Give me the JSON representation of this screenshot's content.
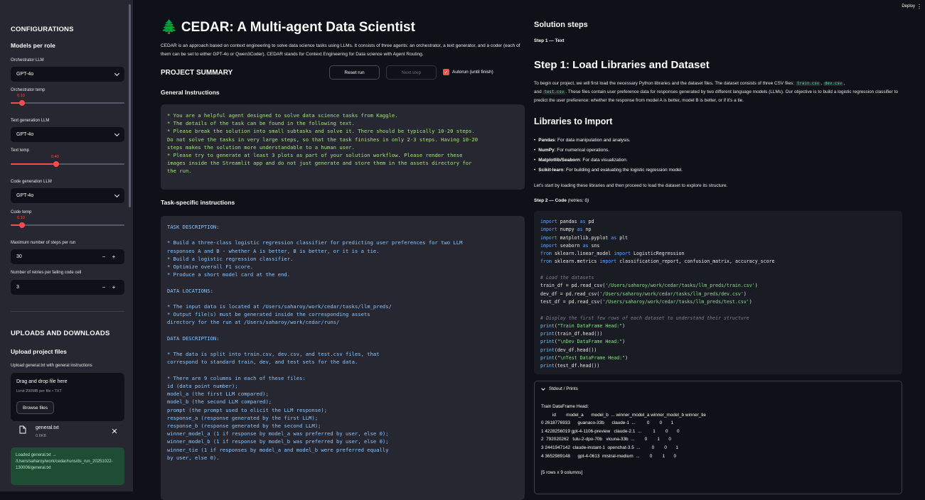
{
  "toolbar": {
    "deploy": "Deploy",
    "menu": "⋮"
  },
  "sidebar": {
    "configurations": "CONFIGURATIONS",
    "models_per_role": "Models per role",
    "orchestrator_llm_label": "Orchestrator LLM",
    "orchestrator_llm": "GPT-4o",
    "orchestrator_temp_label": "Orchestrator temp",
    "orchestrator_temp": "0.10",
    "orchestrator_temp_fraction": 0.1,
    "text_llm_label": "Text generation LLM",
    "text_llm": "GPT-4o",
    "text_temp_label": "Text temp",
    "text_temp": "0.40",
    "text_temp_fraction": 0.4,
    "code_llm_label": "Code generation LLM",
    "code_llm": "GPT-4o",
    "code_temp_label": "Code temp",
    "code_temp": "0.10",
    "code_temp_fraction": 0.1,
    "max_steps_label": "Maximum number of steps per run",
    "max_steps": "30",
    "retries_label": "Number of retries per failing code cell",
    "retries": "3",
    "minus": "−",
    "plus": "+",
    "uploads_downloads": "UPLOADS AND DOWNLOADS",
    "upload_project_files": "Upload project files",
    "upload_general_label": "Upload general.txt with general instructions",
    "drag_drop": "Drag and drop file here",
    "limit": "Limit 200MB per file • TXT",
    "browse": "Browse files",
    "file_name": "general.txt",
    "file_size": "0.6KB",
    "success": "Loaded general.txt → /Users/saharoy/work/cedar/runs/ds_run_20251022-130006/general.txt"
  },
  "main": {
    "title": "🌲 CEDAR: A Multi-agent Data Scientist",
    "intro": "CEDAR is an approach based on context engineering to solve data science tasks using LLMs. It consists of three agents: an orchestrator, a text generator, and a coder (each of them can be set to either GPT-4o or Qwen3Coder). CEDAR stands for Context Engineering for Data science with Agent Routing.",
    "project_summary": "PROJECT SUMMARY",
    "reset_run": "Reset run",
    "next_step": "Next step",
    "autorun": "Autorun (until finish)",
    "general_instructions": "General Instructions",
    "general_text": "* You are a helpful agent designed to solve data science tasks from Kaggle.\n* The details of the task can be found in the following text.\n* Please break the solution into small subtasks and solve it. There should be typically 10-20 steps.\nDo not solve the tasks in very large steps, so that the task finishes in only 2-3 steps. Having 10-20\nsteps makes the solution more understandable to a human user.\n* Please try to generate at least 3 plots as part of your solution workflow. Please render these\nimages inside the Streamlit app and do not just generate and store them in the assets directory for\nthe run.",
    "task_specific": "Task-specific instructions",
    "task_text": "TASK DESCRIPTION:\n\n* Build a three-class logistic regression classifier for predicting user preferences for two LLM\nresponses A and B - whether A is better, B is better, or it is a tie.\n* Build a logistic regression classifier.\n* Optimize overall F1 score.\n* Produce a short model card at the end.\n\nDATA LOCATIONS:\n\n* The input data is located at /Users/saharoy/work/cedar/tasks/llm_preds/\n* Output file(s) must be generated inside the corresponding assets\ndirectory for the run at /Users/saharoy/work/cedar/runs/\n\nDATA DESCRIPTION:\n\n* The data is split into train.csv, dev.csv, and test.csv files, that\ncorrespond to standard train, dev, and test sets for the data.\n\n* There are 9 columns in each of these files:\nid (data point number);\nmodel_a (the first LLM compared);\nmodel_b (the second LLM compared);\nprompt (the prompt used to elicit the LLM response);\nresponse_a (response generated by the first LLM);\nresponse_b (response generated by the second LLM);\nwinner_model_a (1 if response by model_a was preferred by user, else 0);\nwinner_model_b (1 if response by model_b was preferred by user, else 0);\nwinner_tie (1 if responses by model_a and model_b were preferred equally\nby user, else 0)."
  },
  "right": {
    "solution_steps": "Solution steps",
    "step1_label": "Step 1 — Text",
    "step1_title": "Step 1: Load Libraries and Dataset",
    "p1_a": "To begin our project, we will first load the necessary Python libraries and the dataset files. The dataset consists of three CSV files: ",
    "file1": "train.csv",
    "sep": ", ",
    "file2": "dev.csv",
    "p1_b": ",",
    "p1_c": "and ",
    "file3": "test.csv",
    "p1_d": ". These files contain user preference data for responses generated by two different language models (LLMs). Our objective is to build a logistic regression classifier to predict the user preference: whether the response from model A is better, model B is better, or if it's a tie.",
    "libraries_title": "Libraries to Import",
    "libs": [
      {
        "name": "Pandas",
        "desc": ": For data manipulation and analysis."
      },
      {
        "name": "NumPy",
        "desc": ": For numerical operations."
      },
      {
        "name": "Matplotlib/Seaborn",
        "desc": ": For data visualization."
      },
      {
        "name": "Scikit-learn",
        "desc": ": For building and evaluating the logistic regression model."
      }
    ],
    "lets_start": "Let's start by loading these libraries and then proceed to load the dataset to explore its structure.",
    "step2_label": "Step 2 — Code",
    "step2_retries": "(retries: 0)",
    "code_lines": [
      [
        [
          "kw",
          "import"
        ],
        [
          "fn",
          " pandas "
        ],
        [
          "kw",
          "as"
        ],
        [
          "fn",
          " pd"
        ]
      ],
      [
        [
          "kw",
          "import"
        ],
        [
          "fn",
          " numpy "
        ],
        [
          "kw",
          "as"
        ],
        [
          "fn",
          " np"
        ]
      ],
      [
        [
          "kw",
          "import"
        ],
        [
          "fn",
          " matplotlib.pyplot "
        ],
        [
          "kw",
          "as"
        ],
        [
          "fn",
          " plt"
        ]
      ],
      [
        [
          "kw",
          "import"
        ],
        [
          "fn",
          " seaborn "
        ],
        [
          "kw",
          "as"
        ],
        [
          "fn",
          " sns"
        ]
      ],
      [
        [
          "kw",
          "from"
        ],
        [
          "fn",
          " sklearn.linear_model "
        ],
        [
          "kw",
          "import"
        ],
        [
          "fn",
          " LogisticRegression"
        ]
      ],
      [
        [
          "kw",
          "from"
        ],
        [
          "fn",
          " sklearn.metrics "
        ],
        [
          "kw",
          "import"
        ],
        [
          "fn",
          " classification_report, confusion_matrix, accuracy_score"
        ]
      ],
      [],
      [
        [
          "cm",
          "# Load the datasets"
        ]
      ],
      [
        [
          "fn",
          "train_df = pd.read_csv("
        ],
        [
          "st",
          "'/Users/saharoy/work/cedar/tasks/llm_preds/train.csv'"
        ],
        [
          "fn",
          ")"
        ]
      ],
      [
        [
          "fn",
          "dev_df = pd.read_csv("
        ],
        [
          "st",
          "'/Users/saharoy/work/cedar/tasks/llm_preds/dev.csv'"
        ],
        [
          "fn",
          ")"
        ]
      ],
      [
        [
          "fn",
          "test_df = pd.read_csv("
        ],
        [
          "st",
          "'/Users/saharoy/work/cedar/tasks/llm_preds/test.csv'"
        ],
        [
          "fn",
          ")"
        ]
      ],
      [],
      [
        [
          "cm",
          "# Display the first few rows of each dataset to understand their structure"
        ]
      ],
      [
        [
          "pr",
          "print"
        ],
        [
          "fn",
          "("
        ],
        [
          "st",
          "\"Train DataFrame Head:\""
        ],
        [
          "fn",
          ")"
        ]
      ],
      [
        [
          "pr",
          "print"
        ],
        [
          "fn",
          "(train_df.head())"
        ]
      ],
      [
        [
          "pr",
          "print"
        ],
        [
          "fn",
          "("
        ],
        [
          "st",
          "\"\\nDev DataFrame Head:\""
        ],
        [
          "fn",
          ")"
        ]
      ],
      [
        [
          "pr",
          "print"
        ],
        [
          "fn",
          "(dev_df.head())"
        ]
      ],
      [
        [
          "pr",
          "print"
        ],
        [
          "fn",
          "("
        ],
        [
          "st",
          "\"\\nTest DataFrame Head:\""
        ],
        [
          "fn",
          ")"
        ]
      ],
      [
        [
          "pr",
          "print"
        ],
        [
          "fn",
          "(test_df.head())"
        ]
      ]
    ],
    "stdout_label": "Stdout / Prints",
    "stdout": "Train DataFrame Head:\n         id        model_a      model_b  ... winner_model_a winner_model_b winner_tie\n0 2618776933      guanaco-33b      claude-1  ...         0        0       1\n1 4228256019 gpt-4-1106-preview   claude-2.1  ...         1        0       0\n2  792020262   tulu-2-dpo-70b   vicuna-33b  ...        0        1       0\n3 2441947142  claude-instant-1  openchat-3.5  ...         0        0       1\n4 3652989148      gpt-4-0613  mistral-medium  ...        0        1       0\n\n[5 rows x 9 columns]"
  }
}
